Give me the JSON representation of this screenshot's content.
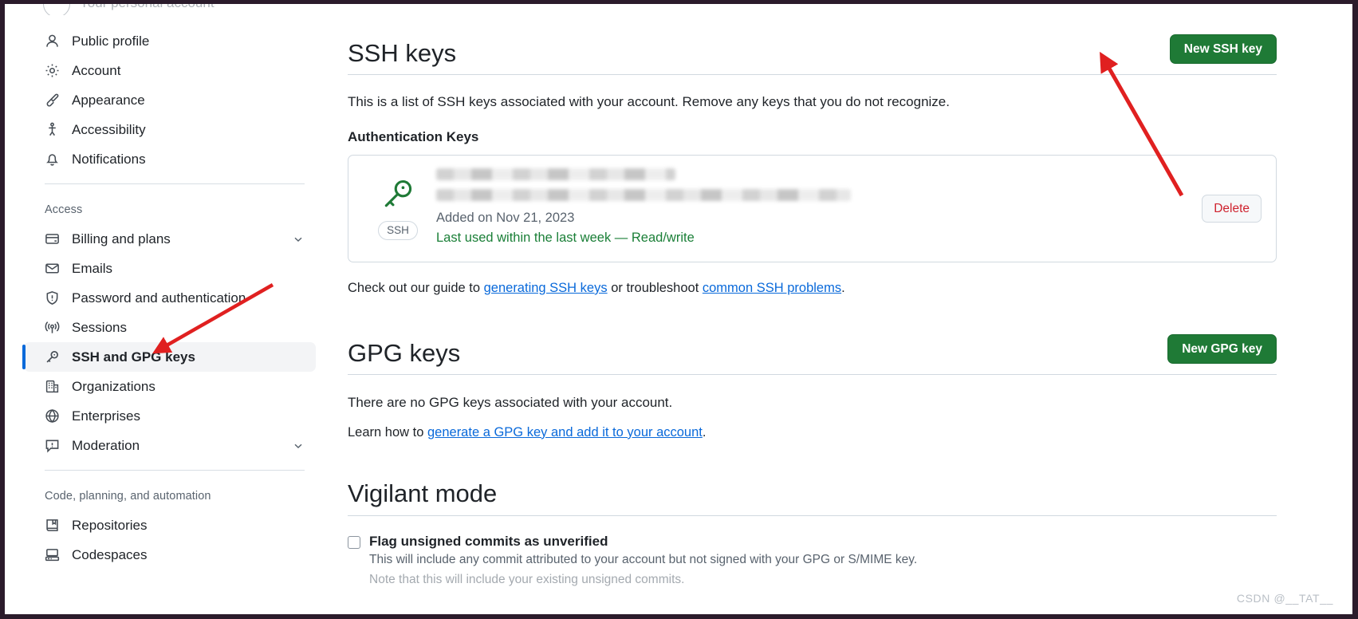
{
  "account": {
    "label": "Your personal account",
    "avatar_icon": "avatar-icon"
  },
  "sidebar": {
    "groups": [
      {
        "heading": null,
        "items": [
          {
            "label": "Public profile",
            "icon": "person-icon",
            "selected": false,
            "chevron": false
          },
          {
            "label": "Account",
            "icon": "gear-icon",
            "selected": false,
            "chevron": false
          },
          {
            "label": "Appearance",
            "icon": "paintbrush-icon",
            "selected": false,
            "chevron": false
          },
          {
            "label": "Accessibility",
            "icon": "accessibility-icon",
            "selected": false,
            "chevron": false
          },
          {
            "label": "Notifications",
            "icon": "bell-icon",
            "selected": false,
            "chevron": false
          }
        ]
      },
      {
        "heading": "Access",
        "items": [
          {
            "label": "Billing and plans",
            "icon": "credit-card-icon",
            "selected": false,
            "chevron": true
          },
          {
            "label": "Emails",
            "icon": "mail-icon",
            "selected": false,
            "chevron": false
          },
          {
            "label": "Password and authentication",
            "icon": "shield-icon",
            "selected": false,
            "chevron": false
          },
          {
            "label": "Sessions",
            "icon": "broadcast-icon",
            "selected": false,
            "chevron": false
          },
          {
            "label": "SSH and GPG keys",
            "icon": "key-icon",
            "selected": true,
            "chevron": false
          },
          {
            "label": "Organizations",
            "icon": "organization-icon",
            "selected": false,
            "chevron": false
          },
          {
            "label": "Enterprises",
            "icon": "globe-icon",
            "selected": false,
            "chevron": false
          },
          {
            "label": "Moderation",
            "icon": "report-icon",
            "selected": false,
            "chevron": true
          }
        ]
      },
      {
        "heading": "Code, planning, and automation",
        "items": [
          {
            "label": "Repositories",
            "icon": "repo-icon",
            "selected": false,
            "chevron": false
          },
          {
            "label": "Codespaces",
            "icon": "codespaces-icon",
            "selected": false,
            "chevron": false
          }
        ]
      }
    ]
  },
  "ssh_section": {
    "title": "SSH keys",
    "new_key_button": "New SSH key",
    "description": "This is a list of SSH keys associated with your account. Remove any keys that you do not recognize.",
    "subheading": "Authentication Keys",
    "key_card": {
      "badge": "SSH",
      "title_redacted": true,
      "fingerprint_redacted": true,
      "added_on": "Added on Nov 21, 2023",
      "status": "Last used within the last week — Read/write",
      "delete_button": "Delete"
    },
    "guide_prefix": "Check out our guide to ",
    "guide_link_1": "generating SSH keys",
    "guide_middle": " or troubleshoot ",
    "guide_link_2": "common SSH problems",
    "guide_suffix": "."
  },
  "gpg_section": {
    "title": "GPG keys",
    "new_key_button": "New GPG key",
    "empty_text": "There are no GPG keys associated with your account.",
    "learn_prefix": "Learn how to ",
    "learn_link": "generate a GPG key and add it to your account",
    "learn_suffix": "."
  },
  "vigilant_section": {
    "title": "Vigilant mode",
    "checkbox_label": "Flag unsigned commits as unverified",
    "checkbox_checked": false,
    "description_line_1": "This will include any commit attributed to your account but not signed with your GPG or S/MIME key.",
    "description_line_2": "Note that this will include your existing unsigned commits."
  },
  "watermark": "CSDN @__TAT__",
  "colors": {
    "green_button": "#1f7a36",
    "link_blue": "#0969da",
    "status_green": "#1a7f37",
    "danger_red": "#cf222e",
    "selected_accent": "#0969da",
    "annotation_red": "#e02020"
  }
}
